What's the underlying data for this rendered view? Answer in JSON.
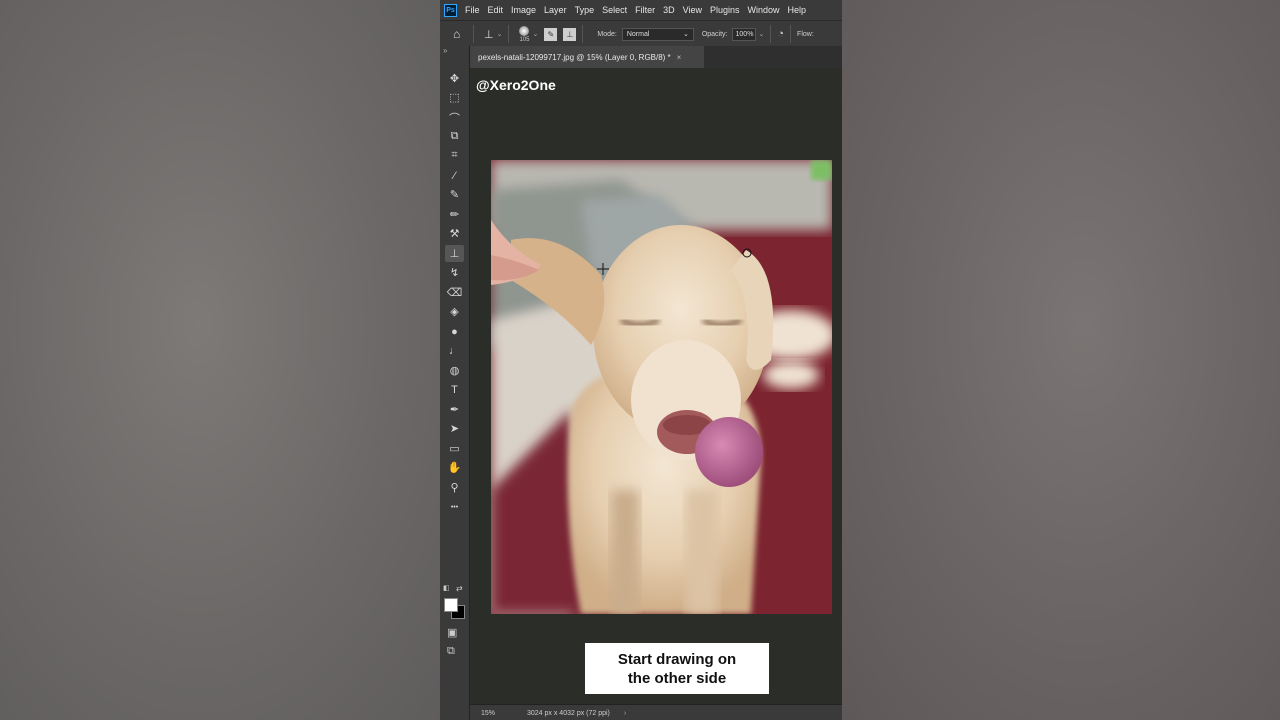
{
  "menubar": {
    "logo": "Ps",
    "items": [
      "File",
      "Edit",
      "Image",
      "Layer",
      "Type",
      "Select",
      "Filter",
      "3D",
      "View",
      "Plugins",
      "Window",
      "Help"
    ]
  },
  "options_bar": {
    "brush_size": "105",
    "mode_label": "Mode:",
    "mode_value": "Normal",
    "opacity_label": "Opacity:",
    "opacity_value": "100%",
    "flow_label": "Flow:"
  },
  "document": {
    "tab_title": "pexels-natali-12099717.jpg @ 15% (Layer 0, RGB/8) *",
    "close_glyph": "×"
  },
  "tools": [
    {
      "name": "move-tool",
      "glyph": "✥"
    },
    {
      "name": "marquee-tool",
      "glyph": "⬚"
    },
    {
      "name": "lasso-tool",
      "glyph": "⌒"
    },
    {
      "name": "object-select-tool",
      "glyph": "⧉"
    },
    {
      "name": "crop-tool",
      "glyph": "⌗"
    },
    {
      "name": "eyedropper-tool",
      "glyph": "⁄"
    },
    {
      "name": "healing-brush-tool",
      "glyph": "✎"
    },
    {
      "name": "brush-tool",
      "glyph": "✏"
    },
    {
      "name": "clone-stamp-variant-tool",
      "glyph": "⚒"
    },
    {
      "name": "clone-stamp-tool",
      "glyph": "⊥"
    },
    {
      "name": "history-brush-tool",
      "glyph": "↯"
    },
    {
      "name": "eraser-tool",
      "glyph": "⌫"
    },
    {
      "name": "paint-bucket-tool",
      "glyph": "◈"
    },
    {
      "name": "blur-tool",
      "glyph": "●"
    },
    {
      "name": "dodge-tool",
      "glyph": "♩"
    },
    {
      "name": "sponge-tool",
      "glyph": "◍"
    },
    {
      "name": "type-tool",
      "glyph": "T"
    },
    {
      "name": "pen-tool",
      "glyph": "✒"
    },
    {
      "name": "path-select-tool",
      "glyph": "➤"
    },
    {
      "name": "rectangle-tool",
      "glyph": "▭"
    },
    {
      "name": "hand-tool",
      "glyph": "✋"
    },
    {
      "name": "zoom-tool",
      "glyph": "⚲"
    },
    {
      "name": "more-tools",
      "glyph": "•••"
    }
  ],
  "active_tool": "clone-stamp-tool",
  "canvas": {
    "watermark": "@Xero2One",
    "caption": "Start drawing on\nthe other side"
  },
  "statusbar": {
    "zoom": "15%",
    "doc_info": "3024 px x 4032 px (72 ppi)",
    "arrow": "›"
  },
  "colors": {
    "foreground": "#ffffff",
    "background": "#000000",
    "canvas_bg": "#2b2d28",
    "panel_bg": "#3a3a3a"
  }
}
